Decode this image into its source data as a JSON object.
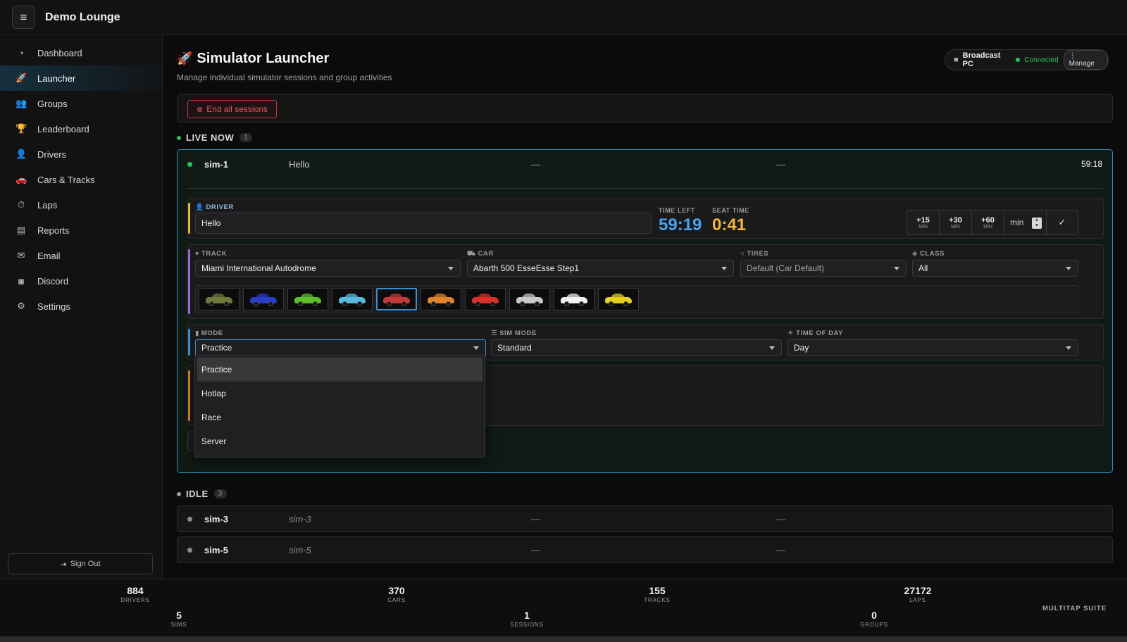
{
  "app": {
    "title": "Demo Lounge"
  },
  "sidebar": {
    "items": [
      {
        "label": "Dashboard",
        "icon": "dashboard-icon",
        "glyph": "◔"
      },
      {
        "label": "Launcher",
        "icon": "rocket-icon",
        "glyph": "🚀",
        "active": true
      },
      {
        "label": "Groups",
        "icon": "users-icon",
        "glyph": "👥"
      },
      {
        "label": "Leaderboard",
        "icon": "trophy-icon",
        "glyph": "🏆"
      },
      {
        "label": "Drivers",
        "icon": "driver-icon",
        "glyph": "👤"
      },
      {
        "label": "Cars & Tracks",
        "icon": "car-icon",
        "glyph": "🚗"
      },
      {
        "label": "Laps",
        "icon": "stopwatch-icon",
        "glyph": "⏱"
      },
      {
        "label": "Reports",
        "icon": "chart-icon",
        "glyph": "▤"
      },
      {
        "label": "Email",
        "icon": "envelope-icon",
        "glyph": "✉"
      },
      {
        "label": "Discord",
        "icon": "discord-icon",
        "glyph": "◙"
      },
      {
        "label": "Settings",
        "icon": "gear-icon",
        "glyph": "⚙"
      }
    ],
    "sign_out": "Sign Out"
  },
  "page": {
    "title": "Simulator Launcher",
    "subtitle": "Manage individual simulator sessions and group activities"
  },
  "broadcast": {
    "name": "Broadcast PC",
    "status": "Connected",
    "manage": "Manage",
    "status_color": "#2fbf5a"
  },
  "end_all": "End all sessions",
  "live": {
    "label": "LIVE NOW",
    "count": "1",
    "session": {
      "name": "sim-1",
      "driver": "Hello",
      "car": "—",
      "track": "—",
      "time": "59:18",
      "driver_label": "DRIVER",
      "driver_value": "Hello",
      "time_left_label": "TIME LEFT",
      "time_left": "59:19",
      "seat_time_label": "SEAT TIME",
      "seat_time": "0:41",
      "adjust": [
        {
          "value": "+15",
          "unit": "MIN"
        },
        {
          "value": "+30",
          "unit": "MIN"
        },
        {
          "value": "+60",
          "unit": "MIN"
        }
      ],
      "custom_unit": "min",
      "track_label": "TRACK",
      "track_value": "Miami International Autodrome",
      "car_label": "CAR",
      "car_value": "Abarth 500 EsseEsse Step1",
      "tires_label": "TIRES",
      "tires_value": "Default (Car Default)",
      "class_label": "CLASS",
      "class_value": "All",
      "liveries": [
        "#6d7a3a",
        "#2a3ec9",
        "#5fbf2a",
        "#5ab8e0",
        "#c43a3a",
        "#e0842a",
        "#d9302a",
        "#c8c8c8",
        "#f0f0f0",
        "#e6d21e"
      ],
      "selected_livery": 4,
      "mode_label": "MODE",
      "mode_value": "Practice",
      "sim_mode_label": "SIM MODE",
      "sim_mode_value": "Standard",
      "tod_label": "TIME OF DAY",
      "tod_value": "Day",
      "mode_options": [
        "Practice",
        "Hotlap",
        "Race",
        "Server"
      ]
    }
  },
  "idle": {
    "label": "IDLE",
    "count": "3",
    "sessions": [
      {
        "name": "sim-3",
        "driver": "sim-3",
        "car": "—",
        "track": "—"
      },
      {
        "name": "sim-5",
        "driver": "sim-5",
        "car": "—",
        "track": "—"
      }
    ]
  },
  "stats": [
    {
      "value": "884",
      "label": "DRIVERS"
    },
    {
      "value": "370",
      "label": "CARS"
    },
    {
      "value": "155",
      "label": "TRACKS"
    },
    {
      "value": "27172",
      "label": "LAPS"
    },
    {
      "value": "5",
      "label": "SIMS"
    },
    {
      "value": "1",
      "label": "SESSIONS"
    },
    {
      "value": "0",
      "label": "GROUPS"
    }
  ],
  "brand": "MULTITAP SUITE",
  "colors": {
    "accent": "#4aa3f0",
    "time_left": "#4aa3f0",
    "seat_time": "#f2b53a",
    "live_dot": "#2fbf5a",
    "danger": "#e05a5c"
  }
}
